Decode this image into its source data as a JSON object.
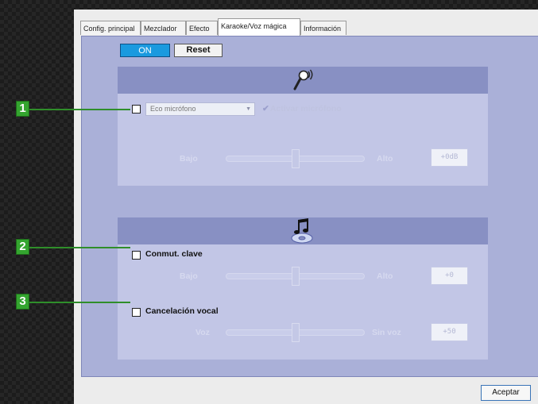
{
  "tabs": [
    {
      "label": "Config. principal",
      "active": false
    },
    {
      "label": "Mezclador",
      "active": false
    },
    {
      "label": "Efecto",
      "active": false
    },
    {
      "label": "Karaoke/Voz mágica",
      "active": true
    },
    {
      "label": "Información",
      "active": false
    }
  ],
  "toolbar": {
    "on_label": "ON",
    "reset_label": "Reset"
  },
  "mic_section": {
    "icon": "microphone-icon",
    "dropdown_value": "Eco micrófono",
    "activate_label": "Activar micrófono",
    "slider_low": "Bajo",
    "slider_high": "Alto",
    "value": "+0dB"
  },
  "music_section": {
    "icon": "music-disc-icon",
    "key_shift": {
      "label": "Conmut. clave",
      "low": "Bajo",
      "high": "Alto",
      "value": "+0"
    },
    "vocal_cancel": {
      "label": "Cancelación vocal",
      "low": "Voz",
      "high": "Sin voz",
      "value": "+50"
    }
  },
  "callouts": [
    "1",
    "2",
    "3"
  ],
  "accept_label": "Aceptar",
  "colors": {
    "accent": "#1a9adf",
    "panel": "#aab0d8",
    "section_header": "#8890c3",
    "callout": "#34a52f"
  }
}
